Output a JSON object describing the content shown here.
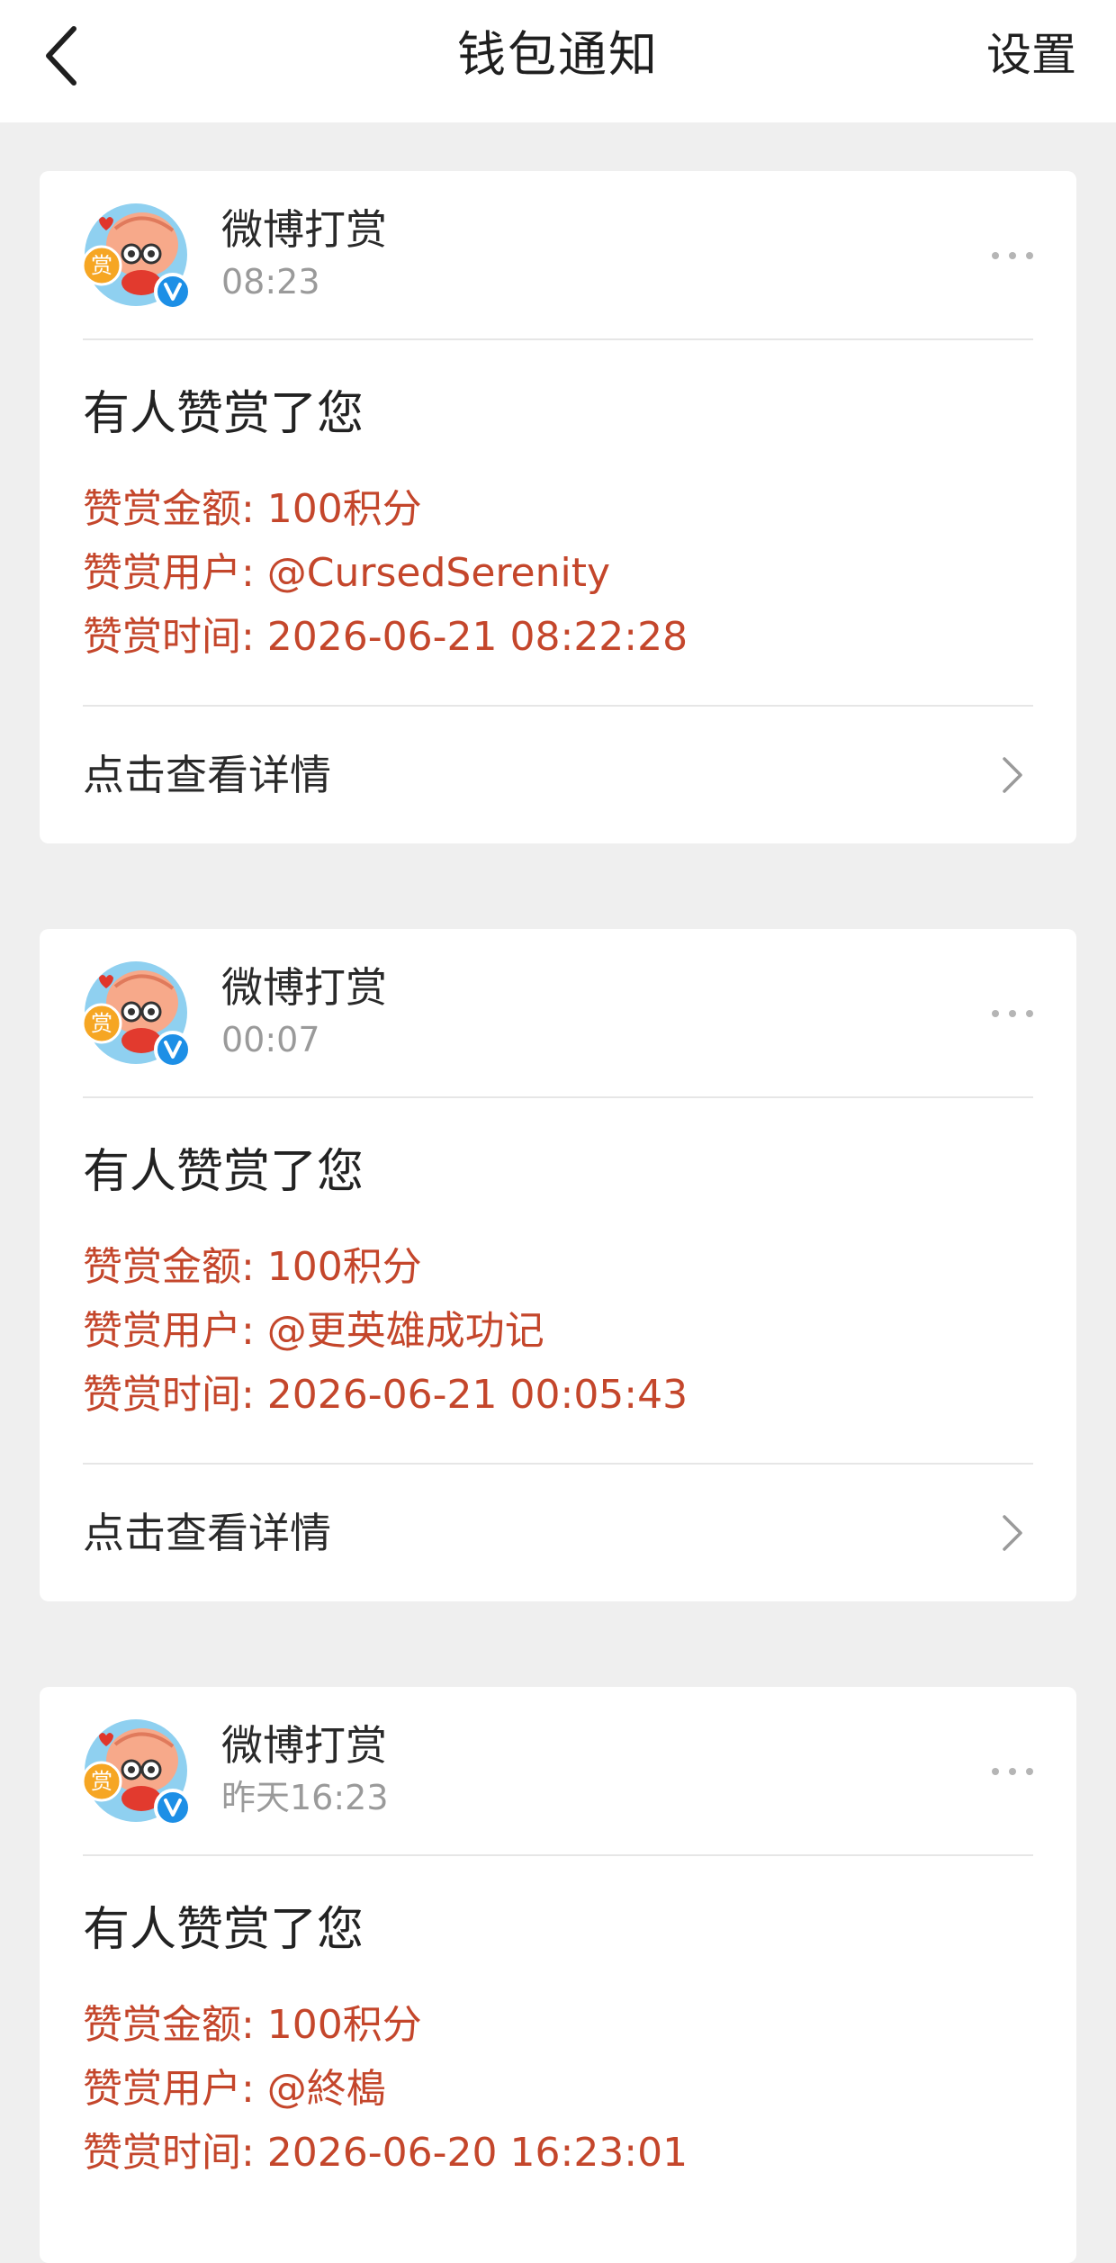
{
  "header": {
    "title": "钱包通知",
    "settings_label": "设置"
  },
  "avatar_badge_text": "赏",
  "colors": {
    "accent_red": "#c4462b",
    "verified_blue": "#1d8fe6",
    "background": "#efefef"
  },
  "notifications": [
    {
      "sender": "微博打赏",
      "time": "08:23",
      "title": "有人赞赏了您",
      "amount": "赞赏金额: 100积分",
      "user": "赞赏用户: @CursedSerenity",
      "reward_time": "赞赏时间: 2026-06-21 08:22:28",
      "detail_link": "点击查看详情"
    },
    {
      "sender": "微博打赏",
      "time": "00:07",
      "title": "有人赞赏了您",
      "amount": "赞赏金额: 100积分",
      "user": "赞赏用户: @更英雄成功记",
      "reward_time": "赞赏时间: 2026-06-21 00:05:43",
      "detail_link": "点击查看详情"
    },
    {
      "sender": "微博打赏",
      "time": "昨天16:23",
      "title": "有人赞赏了您",
      "amount": "赞赏金额: 100积分",
      "user": "赞赏用户: @終槝",
      "reward_time": "赞赏时间: 2026-06-20 16:23:01"
    }
  ]
}
